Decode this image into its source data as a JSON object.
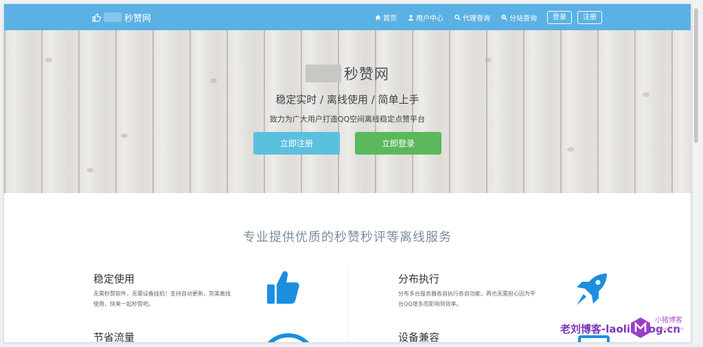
{
  "navbar": {
    "brand": "秒赞网",
    "links": [
      "首页",
      "用户中心",
      "代理查询",
      "分站查询"
    ],
    "login_button": "登录",
    "register_button": "注册"
  },
  "hero": {
    "title": "秒赞网",
    "subtitle": "稳定实时 / 离线使用 / 简单上手",
    "description": "致力为广大用户打造QQ空间离线稳定点赞平台",
    "register_button": "立即注册",
    "login_button": "立即登录"
  },
  "section": {
    "title": "专业提供优质的秒赞秒评等离线服务"
  },
  "features": [
    {
      "title": "稳定使用",
      "desc_line1": "无需秒赞软件，无需设备挂机！支持自动更新，完美离线",
      "desc_line2": "使用，快来一起秒赞吧。"
    },
    {
      "title": "分布执行",
      "desc_line1": "分布多台服务器各自执行各自功能，再也无需担心因为平",
      "desc_line2": "台QQ增多而影响到效率。"
    },
    {
      "title": "节省流量"
    },
    {
      "title": "设备兼容"
    }
  ],
  "watermark": {
    "text": "老刘博客-laoliublog.cn",
    "side_text": "小猪博客",
    "side_small": "xjrame.com"
  },
  "colors": {
    "navbar": "#5bb1e4",
    "register": "#5bc0de",
    "login": "#5cb85c",
    "icon": "#1a8fe0"
  }
}
